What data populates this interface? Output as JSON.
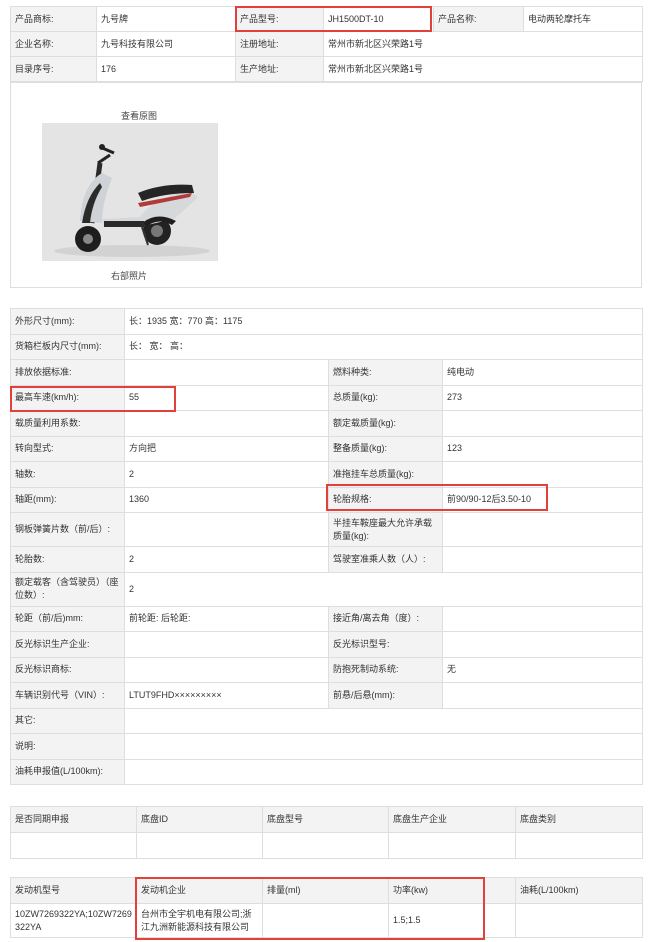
{
  "header": {
    "rows": [
      [
        {
          "label": "产品商标:",
          "value": "九号牌"
        },
        {
          "label": "产品型号:",
          "value": "JH1500DT-10"
        },
        {
          "label": "产品名称:",
          "value": "电动两轮摩托车"
        }
      ],
      [
        {
          "label": "企业名称:",
          "value": "九号科技有限公司"
        },
        {
          "label": "注册地址:",
          "value": "常州市新北区兴荣路1号"
        }
      ],
      [
        {
          "label": "目录序号:",
          "value": "176"
        },
        {
          "label": "生产地址:",
          "value": "常州市新北区兴荣路1号"
        }
      ]
    ]
  },
  "photo": {
    "view_original": "查看原图",
    "caption": "右部照片"
  },
  "specs": {
    "outer_size": {
      "label": "外形尺寸(mm):",
      "value": "长：1935 宽：770 高：1175"
    },
    "cargo_size": {
      "label": "货箱栏板内尺寸(mm):",
      "value": "长：  宽：  高："
    },
    "rows": [
      [
        {
          "label": "排放依据标准:",
          "value": ""
        },
        {
          "label": "燃料种类:",
          "value": "纯电动"
        }
      ],
      [
        {
          "label": "最高车速(km/h):",
          "value": "55"
        },
        {
          "label": "总质量(kg):",
          "value": "273"
        }
      ],
      [
        {
          "label": "载质量利用系数:",
          "value": ""
        },
        {
          "label": "额定载质量(kg):",
          "value": ""
        }
      ],
      [
        {
          "label": "转向型式:",
          "value": "方向把"
        },
        {
          "label": "整备质量(kg):",
          "value": "123"
        }
      ],
      [
        {
          "label": "轴数:",
          "value": "2"
        },
        {
          "label": "准拖挂车总质量(kg):",
          "value": ""
        }
      ],
      [
        {
          "label": "轴距(mm):",
          "value": "1360"
        },
        {
          "label": "轮胎规格:",
          "value": "前90/90-12后3.50-10"
        }
      ],
      [
        {
          "label": "钢板弹簧片数（前/后）:",
          "value": ""
        },
        {
          "label": "半挂车鞍座最大允许承载质量(kg):",
          "value": ""
        }
      ],
      [
        {
          "label": "轮胎数:",
          "value": "2"
        },
        {
          "label": "驾驶室准乘人数（人）:",
          "value": ""
        }
      ]
    ],
    "rated_load": {
      "label": "额定载客（含驾驶员）（座位数）:",
      "value": "2"
    },
    "rows2": [
      [
        {
          "label": "轮距（前/后)mm:",
          "value": "前轮距: 后轮距:"
        },
        {
          "label": "接近角/离去角（度）:",
          "value": ""
        }
      ],
      [
        {
          "label": "反光标识生产企业:",
          "value": ""
        },
        {
          "label": "反光标识型号:",
          "value": ""
        }
      ],
      [
        {
          "label": "反光标识商标:",
          "value": ""
        },
        {
          "label": "防抱死制动系统:",
          "value": "无"
        }
      ],
      [
        {
          "label": "车辆识别代号（VIN）:",
          "value": "LTUT9FHD×××××××××"
        },
        {
          "label": "前悬/后悬(mm):",
          "value": ""
        }
      ]
    ],
    "other": {
      "label": "其它:",
      "value": ""
    },
    "notes": {
      "label": "说明:",
      "value": ""
    },
    "fuel": {
      "label": "油耗申报值(L/100km):",
      "value": ""
    }
  },
  "chassis": {
    "headers": [
      "是否同期申报",
      "底盘ID",
      "底盘型号",
      "底盘生产企业",
      "底盘类别"
    ],
    "values": [
      "",
      "",
      "",
      "",
      ""
    ]
  },
  "engine": {
    "headers": [
      "发动机型号",
      "发动机企业",
      "排量(ml)",
      "功率(kw)",
      "油耗(L/100km)"
    ],
    "values": [
      "10ZW7269322YA;10ZW7269322YA",
      "台州市全宇机电有限公司;浙江九洲新能源科技有限公司",
      "",
      "1.5;1.5",
      ""
    ]
  },
  "highlight_color": "#e2403a"
}
